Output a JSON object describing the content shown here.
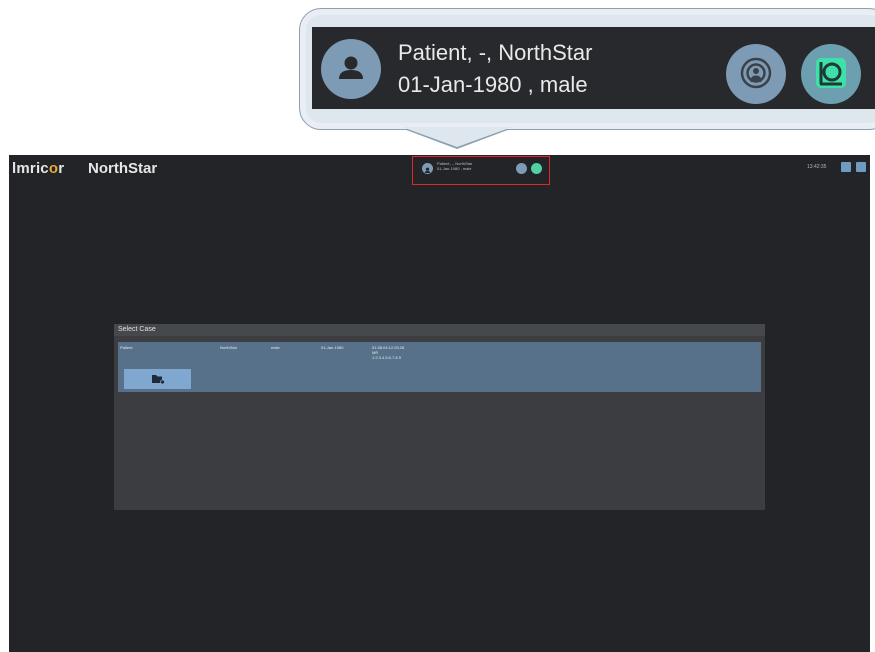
{
  "callout": {
    "patient_line": "Patient, -, NorthStar",
    "dob_line": "01-Jan-1980 , male"
  },
  "header": {
    "logo_prefix": "lmric",
    "logo_highlight": "o",
    "logo_suffix": "r",
    "app_title": "NorthStar",
    "patient_name": "Patient, -, NorthStar",
    "patient_dob": "01-Jan-1980 , male",
    "clock": "13:42:35",
    "logo_accent_color": "#e8a93a"
  },
  "dialog": {
    "title": "Select Case",
    "case": {
      "name": "Patient",
      "last_name": "NorthStar",
      "sex": "male",
      "birth_date": "01-Jan-1980",
      "study_lines": [
        "51.98.04.12.03.28",
        "MR",
        "1.2.3.4.5.6.7.8.9"
      ]
    },
    "open_icon": "folder-icon"
  }
}
